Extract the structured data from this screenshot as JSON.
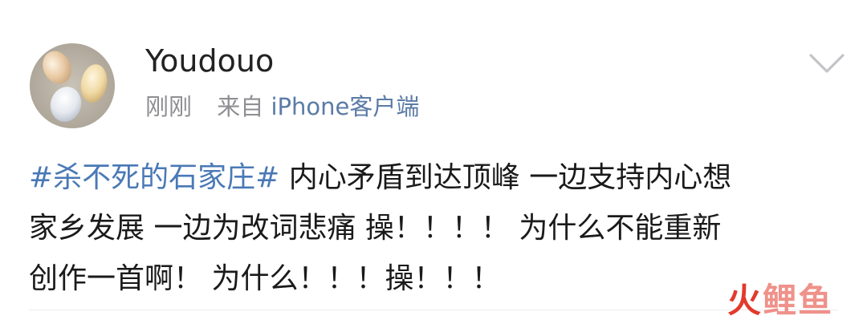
{
  "post": {
    "username": "Youdouo",
    "time": "刚刚",
    "source_prefix": "来自",
    "source_device": "iPhone客户端",
    "content": {
      "hashtag": "#杀不死的石家庄#",
      "line1_rest": " 内心矛盾到达顶峰 一边支持内心想",
      "line2": "家乡发展 一边为改词悲痛 操！！！！ 为什么不能重新",
      "line3": "创作一首啊！ 为什么！！！操！！！"
    }
  },
  "icons": {
    "avatar": "avatar-image",
    "more": "chevron-down-icon"
  },
  "watermark": {
    "char1": "火",
    "char2": "鲤",
    "char3": "鱼"
  },
  "colors": {
    "hashtag": "#4a79b6",
    "device": "#5b7ba6",
    "meta": "#8e8e93",
    "watermark": "#e23a2c"
  }
}
